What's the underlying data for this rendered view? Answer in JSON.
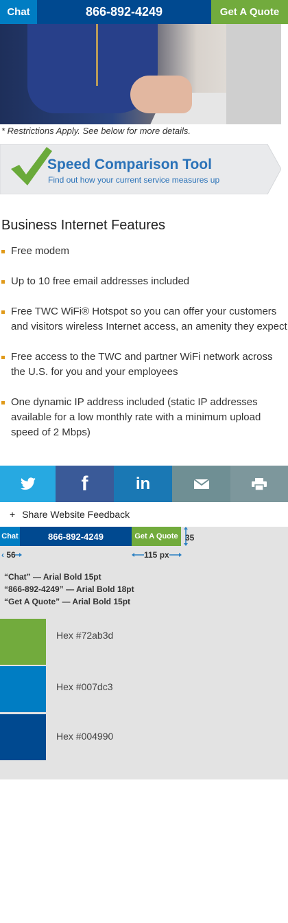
{
  "topbar": {
    "chat_label": "Chat",
    "phone": "866-892-4249",
    "quote_label": "Get A Quote",
    "colors": {
      "chat": "#007dc3",
      "phone": "#004990",
      "quote": "#72ab3d"
    }
  },
  "hero": {
    "note": "* Restrictions Apply. See below for more details."
  },
  "speed_banner": {
    "title": "Speed Comparison Tool",
    "subtitle": "Find out how your current service measures up"
  },
  "features": {
    "heading": "Business Internet Features",
    "items": [
      "Free modem",
      "Up to 10 free email addresses included",
      "Free TWC WiFi® Hotspot so you can offer your customers and visitors wireless Internet access, an amenity they expect",
      "Free access to the TWC and partner WiFi network across the U.S. for you and your employees",
      "One dynamic IP address included (static IP addresses available for a low monthly rate with a minimum upload speed of 2 Mbps)"
    ]
  },
  "share": {
    "icons": [
      "twitter-icon",
      "facebook-icon",
      "linkedin-icon",
      "mail-icon",
      "print-icon"
    ],
    "linkedin_text": "in",
    "facebook_text": "f",
    "colors": [
      "#27a9e1",
      "#3a5a98",
      "#1a78b4",
      "#6f8f94",
      "#7d979c"
    ]
  },
  "feedback": {
    "plus": "+",
    "label": "Share Website Feedback"
  },
  "spec": {
    "mini_chat": "Chat",
    "mini_phone": "866-892-4249",
    "mini_quote": "Get A Quote",
    "dim_height": "35",
    "dim_chat_width": "56",
    "dim_quote_width": "115 px",
    "font_lines": [
      "“Chat” — Arial Bold 15pt",
      "“866-892-4249” — Arial Bold 18pt",
      "“Get A Quote” — Arial Bold 15pt"
    ],
    "swatches": [
      {
        "color": "#72ab3d",
        "label": "Hex #72ab3d"
      },
      {
        "color": "#007dc3",
        "label": "Hex #007dc3"
      },
      {
        "color": "#004990",
        "label": "Hex #004990"
      }
    ]
  }
}
